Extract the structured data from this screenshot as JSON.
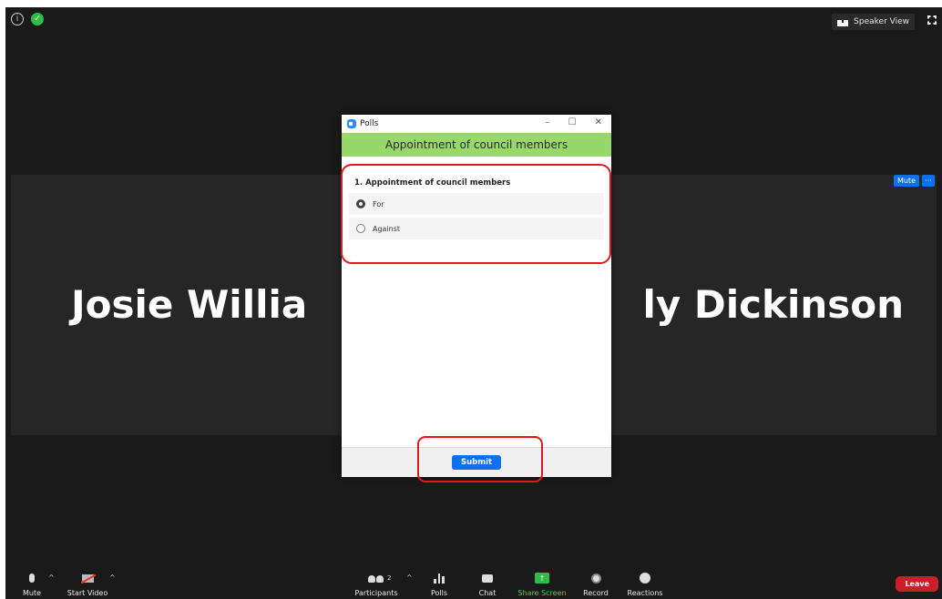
{
  "topbar": {
    "speaker_view_label": "Speaker View"
  },
  "participants_tiles": {
    "left_name_fragment": "Josie Willia",
    "right_name_fragment": "ly Dickinson",
    "mute_label": "Mute",
    "more_label": "···"
  },
  "poll_window": {
    "title": "Polls",
    "header": "Appointment of council members",
    "question": "1. Appointment of council members",
    "options": [
      {
        "label": "For",
        "selected": true
      },
      {
        "label": "Against",
        "selected": false
      }
    ],
    "submit_label": "Submit",
    "window_buttons": {
      "minimize": "–",
      "maximize": "☐",
      "close": "✕"
    }
  },
  "toolbar": {
    "mute": "Mute",
    "start_video": "Start Video",
    "participants": "Participants",
    "participants_count": "2",
    "polls": "Polls",
    "chat": "Chat",
    "share_screen": "Share Screen",
    "record": "Record",
    "reactions": "Reactions",
    "leave": "Leave",
    "caret": "^"
  },
  "colors": {
    "poll_header": "#98d86a",
    "accent_blue": "#0e71eb",
    "leave_red": "#c8202a",
    "share_green": "#2dbd46",
    "highlight_red": "#e8161b"
  }
}
